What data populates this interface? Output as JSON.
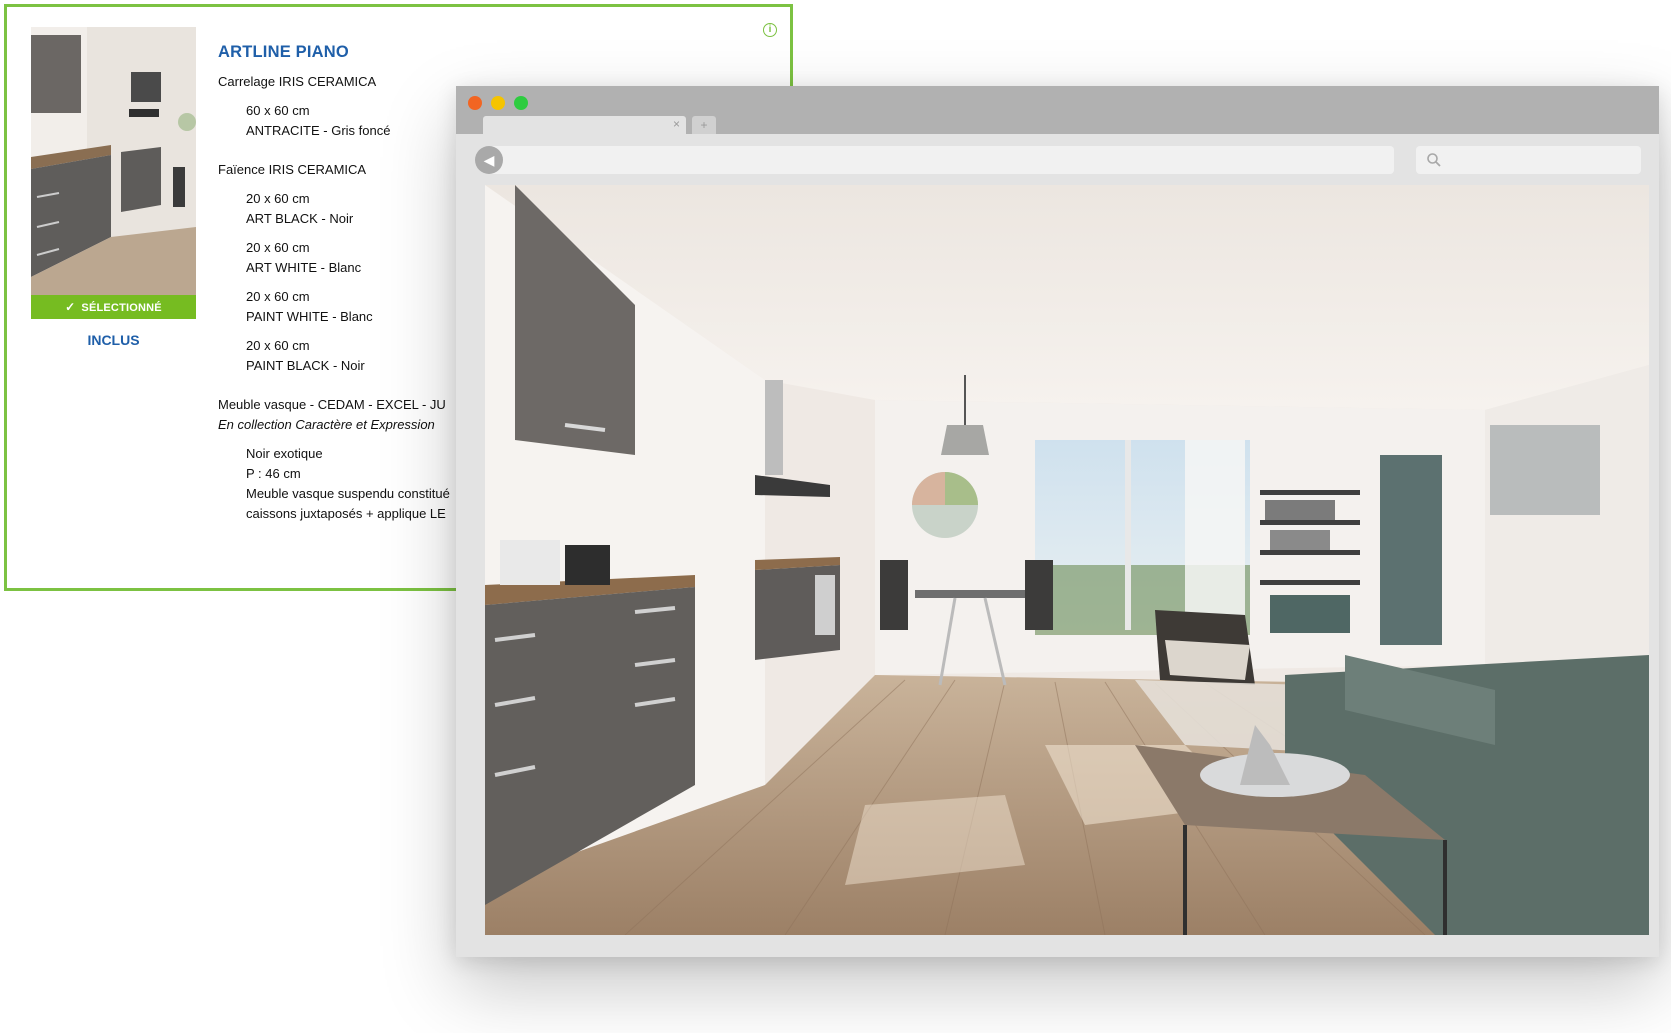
{
  "card": {
    "info_icon": "i",
    "selected_label": "SÉLECTIONNÉ",
    "included_label": "INCLUS",
    "product_title": "ARTLINE PIANO",
    "lines": [
      {
        "text": "Carrelage IRIS CERAMICA",
        "style": "head"
      },
      {
        "text": "60 x 60 cm",
        "style": "sub"
      },
      {
        "text": "ANTRACITE - Gris foncé",
        "style": "sub"
      },
      {
        "text": "Faïence IRIS CERAMICA",
        "style": "head"
      },
      {
        "text": "20 x 60 cm",
        "style": "sub"
      },
      {
        "text": "ART BLACK - Noir",
        "style": "sub"
      },
      {
        "text": "20 x 60 cm",
        "style": "sub"
      },
      {
        "text": "ART WHITE - Blanc",
        "style": "sub"
      },
      {
        "text": "20 x 60 cm",
        "style": "sub"
      },
      {
        "text": "PAINT WHITE - Blanc",
        "style": "sub"
      },
      {
        "text": "20 x 60 cm",
        "style": "sub"
      },
      {
        "text": "PAINT BLACK - Noir",
        "style": "sub"
      },
      {
        "text": "Meuble vasque - CEDAM - EXCEL - JU",
        "style": "head"
      },
      {
        "text": "En collection Caractère et Expression",
        "style": "ital"
      },
      {
        "text": "Noir exotique",
        "style": "sub"
      },
      {
        "text": "P : 46 cm",
        "style": "sub"
      },
      {
        "text": "Meuble vasque suspendu constitué",
        "style": "sub"
      },
      {
        "text": "caissons juxtaposés + applique LE",
        "style": "sub"
      }
    ]
  },
  "browser": {
    "tab_close": "×",
    "new_tab": "+",
    "back": "◀",
    "traffic_lights": [
      "#f26522",
      "#f5c400",
      "#2ecc40"
    ]
  },
  "colors": {
    "accent_green": "#7cc242",
    "badge_green": "#76bc21",
    "title_blue": "#1f5fa9"
  }
}
